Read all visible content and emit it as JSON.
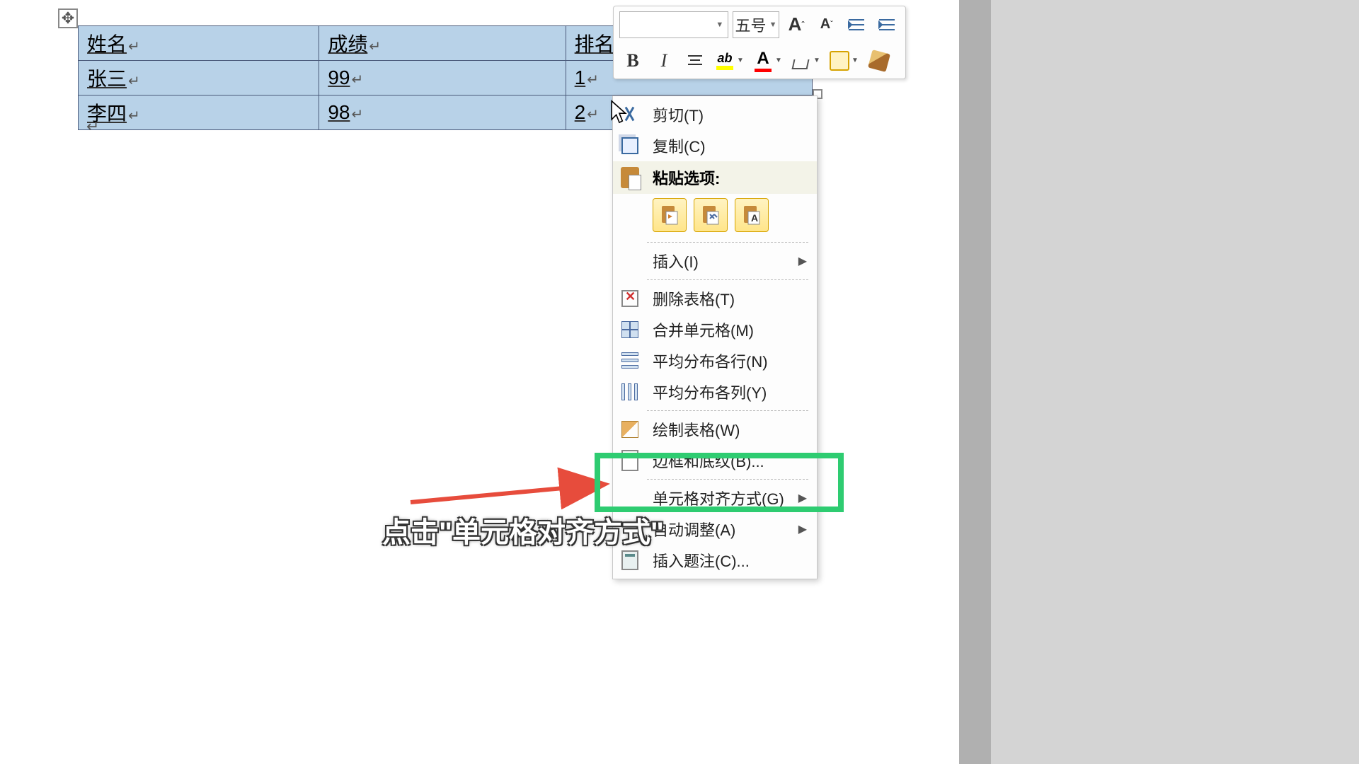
{
  "table": {
    "headers": [
      "姓名",
      "成绩",
      "排名"
    ],
    "rows": [
      [
        "张三",
        "99",
        "1"
      ],
      [
        "李四",
        "98",
        "2"
      ]
    ]
  },
  "mini_toolbar": {
    "font_name": "",
    "font_size": "五号",
    "bold": "B",
    "italic": "I",
    "font_color_letter": "A",
    "highlight_label": "ab",
    "grow_font": "A",
    "shrink_font": "A"
  },
  "context_menu": {
    "cut": "剪切(T)",
    "copy": "复制(C)",
    "paste_header": "粘贴选项:",
    "paste_opts": [
      "",
      "",
      "A"
    ],
    "insert": "插入(I)",
    "delete_table": "删除表格(T)",
    "merge_cells": "合并单元格(M)",
    "distribute_rows": "平均分布各行(N)",
    "distribute_cols": "平均分布各列(Y)",
    "draw_table": "绘制表格(W)",
    "borders_shading": "边框和底纹(B)...",
    "cell_alignment": "单元格对齐方式(G)",
    "autofit": "自动调整(A)",
    "insert_caption": "插入题注(C)..."
  },
  "caption": "点击\"单元格对齐方式\""
}
